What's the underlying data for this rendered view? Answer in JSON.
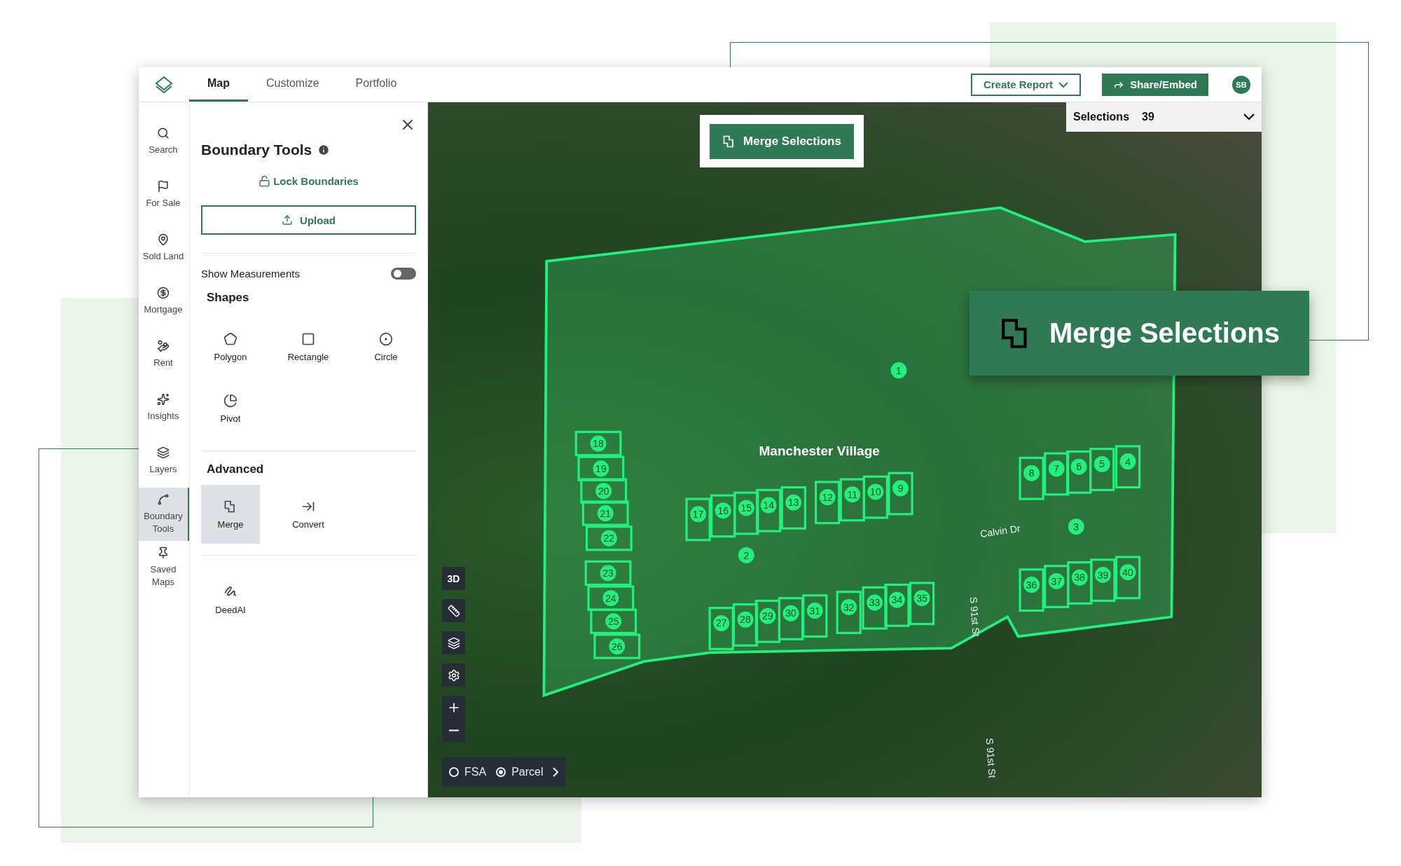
{
  "topbar": {
    "tabs": [
      {
        "label": "Map",
        "selected": true
      },
      {
        "label": "Customize",
        "selected": false
      },
      {
        "label": "Portfolio",
        "selected": false
      }
    ],
    "create_report": "Create Report",
    "share": "Share/Embed",
    "avatar": "SB"
  },
  "nav": [
    {
      "kind": "search",
      "label": "Search",
      "selected": false
    },
    {
      "kind": "sale",
      "label": "For Sale",
      "selected": false
    },
    {
      "kind": "sold",
      "label": "Sold Land",
      "selected": false
    },
    {
      "kind": "mortgage",
      "label": "Mortgage",
      "selected": false
    },
    {
      "kind": "rent",
      "label": "Rent",
      "selected": false
    },
    {
      "kind": "insights",
      "label": "Insights",
      "selected": false
    },
    {
      "kind": "layers",
      "label": "Layers",
      "selected": false
    },
    {
      "kind": "boundary",
      "label": "Boundary Tools",
      "selected": true
    },
    {
      "kind": "saved",
      "label": "Saved Maps",
      "selected": false
    }
  ],
  "panel": {
    "title": "Boundary Tools",
    "lock_link": "Lock Boundaries",
    "upload": "Upload",
    "show_measurements": {
      "label": "Show Measurements",
      "on": false
    },
    "shapes": {
      "heading": "Shapes",
      "tools": [
        {
          "kind": "polygon",
          "label": "Polygon"
        },
        {
          "kind": "rectangle",
          "label": "Rectangle"
        },
        {
          "kind": "circle",
          "label": "Circle"
        },
        {
          "kind": "pivot",
          "label": "Pivot"
        }
      ]
    },
    "advanced": {
      "heading": "Advanced",
      "tools": [
        {
          "kind": "merge",
          "label": "Merge",
          "selected": true
        },
        {
          "kind": "convert",
          "label": "Convert",
          "selected": false
        }
      ]
    },
    "extra_tools": [
      {
        "kind": "deedai",
        "label": "DeedAI"
      }
    ]
  },
  "map": {
    "selections": {
      "label": "Selections",
      "count": "39"
    },
    "merge_button": "Merge Selections",
    "three_d": "3D",
    "layer_options": [
      {
        "label": "FSA",
        "selected": false
      },
      {
        "label": "Parcel",
        "selected": true
      }
    ],
    "place_label": "Manchester Village",
    "street_labels": [
      "Calvin Dr",
      "S 91st St",
      "S 91st St"
    ],
    "parcels": [
      "1",
      "8",
      "7",
      "6",
      "5",
      "4",
      "18",
      "19",
      "20",
      "21",
      "22",
      "17",
      "16",
      "15",
      "14",
      "13",
      "12",
      "11",
      "10",
      "9",
      "3",
      "2",
      "23",
      "24",
      "25",
      "26",
      "27",
      "28",
      "29",
      "30",
      "31",
      "32",
      "33",
      "34",
      "35",
      "36",
      "37",
      "38",
      "39",
      "40"
    ]
  },
  "callout": "Merge Selections"
}
